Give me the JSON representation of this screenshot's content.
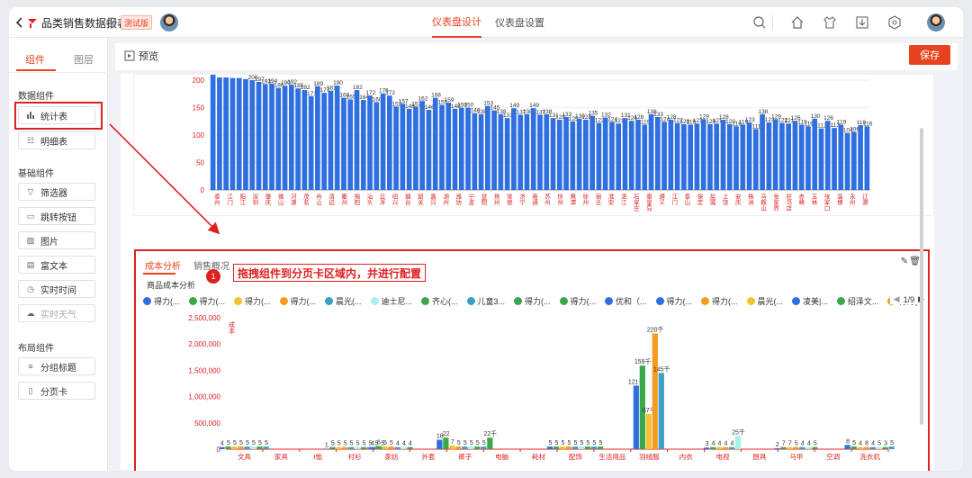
{
  "topbar": {
    "title": "品类销售数据报表",
    "badge": "测试版",
    "tabs": [
      {
        "label": "仪表盘设计",
        "active": true
      },
      {
        "label": "仪表盘设置",
        "active": false
      }
    ],
    "accent": "#e8431f"
  },
  "left_panel": {
    "tabs": [
      {
        "label": "组件",
        "active": true
      },
      {
        "label": "图层",
        "active": false
      }
    ],
    "groups": [
      {
        "title": "数据组件",
        "items": [
          {
            "label": "统计表",
            "icon": "bar-chart-icon"
          },
          {
            "label": "明细表",
            "icon": "list-icon"
          }
        ]
      },
      {
        "title": "基础组件",
        "items": [
          {
            "label": "筛选器",
            "icon": "filter-icon"
          },
          {
            "label": "跳转按钮",
            "icon": "link-button-icon"
          },
          {
            "label": "图片",
            "icon": "image-icon"
          },
          {
            "label": "富文本",
            "icon": "rich-text-icon"
          },
          {
            "label": "实时时间",
            "icon": "clock-icon"
          },
          {
            "label": "实时天气",
            "icon": "cloud-icon"
          }
        ]
      },
      {
        "title": "布局组件",
        "items": [
          {
            "label": "分组标题",
            "icon": "heading-icon"
          },
          {
            "label": "分页卡",
            "icon": "page-card-icon"
          }
        ]
      }
    ]
  },
  "toolbar": {
    "preview_label": "预览",
    "save_label": "保存"
  },
  "panel": {
    "tabs": [
      {
        "label": "成本分析",
        "active": true
      },
      {
        "label": "销售概况",
        "active": false
      }
    ],
    "callout": "拖拽组件到分页卡区域内，并进行配置",
    "callout_step": "1",
    "subtitle": "商品成本分析",
    "legend": [
      {
        "label": "得力(...",
        "color": "#2f6fe0"
      },
      {
        "label": "得力(...",
        "color": "#3aa84a"
      },
      {
        "label": "得力(...",
        "color": "#f2c230"
      },
      {
        "label": "得力(...",
        "color": "#f59a23"
      },
      {
        "label": "晨光(...",
        "color": "#3aa0c8"
      },
      {
        "label": "迪士尼...",
        "color": "#a8f0ee"
      },
      {
        "label": "齐心(...",
        "color": "#3aa84a"
      },
      {
        "label": "儿童3...",
        "color": "#3aa0c8"
      },
      {
        "label": "得力(...",
        "color": "#3aa84a"
      },
      {
        "label": "得力(...",
        "color": "#3aa84a"
      },
      {
        "label": "优和（...",
        "color": "#2f6fe0"
      },
      {
        "label": "得力(...",
        "color": "#2f6fe0"
      },
      {
        "label": "得力(...",
        "color": "#f59a23"
      },
      {
        "label": "晨光(...",
        "color": "#f2c230"
      },
      {
        "label": "凌美|...",
        "color": "#2f6fe0"
      },
      {
        "label": "绍泽文...",
        "color": "#3aa84a"
      },
      {
        "label": "得力(...",
        "color": "#f59a23"
      },
      {
        "label": "",
        "color": "#2f6fe0"
      }
    ],
    "legend_page": "1/9"
  },
  "chart_data": [
    {
      "type": "bar",
      "title": "",
      "categories": [
        "泰州",
        "江门",
        "阳江",
        "深圳",
        "肇庆",
        "佛山",
        "河源",
        "茂名",
        "舟山",
        "清远",
        "衢州",
        "揭阳",
        "汕头",
        "云浮",
        "绍兴",
        "烟台",
        "韶关",
        "嘉兴",
        "湖州",
        "潍坊",
        "宁波",
        "益阳",
        "扬州",
        "常德",
        "济宁",
        "南通",
        "苏州",
        "徐州",
        "鹰潭",
        "徐州",
        "宿迁",
        "淮安",
        "湛江",
        "石家庄",
        "秦皇岛",
        "遵义",
        "江门",
        "泰山",
        "保定",
        "盐城",
        "上饶",
        "安庆",
        "株洲",
        "马鞍山",
        "张家界",
        "驻马店",
        "赤峰",
        "玉林",
        "张家口",
        "淄博",
        "永州",
        "辽源"
      ],
      "values": [
        210,
        205,
        205,
        204,
        204,
        202,
        200,
        197,
        193,
        194,
        186,
        190,
        192,
        185,
        182,
        171,
        189,
        177,
        181,
        190,
        168,
        165,
        182,
        164,
        172,
        160,
        176,
        172,
        152,
        157,
        148,
        152,
        162,
        146,
        168,
        155,
        159,
        148,
        150,
        150,
        140,
        138,
        153,
        145,
        138,
        131,
        149,
        137,
        138,
        149,
        137,
        138,
        131,
        128,
        133,
        125,
        130,
        128,
        135,
        122,
        132,
        124,
        121,
        131,
        126,
        128,
        119,
        138,
        133,
        124,
        128,
        122,
        120,
        119,
        121,
        129,
        120,
        121,
        128,
        120,
        116,
        119,
        123,
        111,
        138,
        123,
        129,
        122,
        121,
        126,
        119,
        116,
        130,
        112,
        126,
        113,
        119,
        104,
        106,
        118,
        116
      ],
      "ylim": [
        0,
        210
      ],
      "yticks": [
        0,
        50,
        100,
        150,
        200
      ],
      "series_color": "#2f6fe0"
    },
    {
      "type": "bar",
      "title": "商品成本分析",
      "categories": [
        "文具",
        "家具",
        "t恤",
        "衬衫",
        "家纺",
        "外套",
        "裤子",
        "电脑",
        "耗材",
        "配饰",
        "生活用品",
        "羽绒服",
        "内衣",
        "电视",
        "厨具",
        "马甲",
        "空调",
        "洗衣机"
      ],
      "ylim": [
        0,
        2500000
      ],
      "yticks": [
        "0",
        "500,000",
        "1,000,000",
        "1,500,000",
        "2,000,000",
        "2,500,000"
      ],
      "ylabel": "成本",
      "groups": [
        {
          "category": "文具",
          "bars": [
            40000,
            50000,
            50000,
            50000,
            50000,
            50000,
            50000,
            50000
          ],
          "labels": [
            "4",
            "5",
            "5",
            "5",
            "5",
            "5",
            "5",
            "5"
          ]
        },
        {
          "category": "衬衫",
          "bars": [
            10000,
            40000,
            40000,
            40000,
            40000,
            40000,
            40000,
            40000,
            40000,
            40000
          ],
          "labels": [
            "1",
            "5",
            "5",
            "5",
            "5",
            "5",
            "5",
            "5",
            "5",
            "5"
          ]
        },
        {
          "category": "家纺",
          "bars": [
            40000,
            60000,
            50000,
            50000,
            40000,
            40000,
            40000
          ],
          "labels": [
            "4",
            "6",
            "5",
            "5",
            "4",
            "4",
            "4"
          ]
        },
        {
          "category": "裤子",
          "bars": [
            180000,
            220000,
            70000,
            50000,
            50000,
            50000,
            50000,
            50000,
            220000
          ],
          "labels": [
            "18",
            "22",
            "7",
            "5",
            "5",
            "5",
            "5",
            "5",
            "22千"
          ]
        },
        {
          "category": "配饰",
          "bars": [
            50000,
            50000,
            50000,
            50000,
            50000,
            50000,
            50000,
            50000,
            50000
          ],
          "labels": [
            "5",
            "5",
            "5",
            "5",
            "5",
            "5",
            "5",
            "5",
            "5"
          ]
        },
        {
          "category": "羽绒服",
          "bars": [
            1210000,
            1590000,
            670000,
            2200000,
            1450000
          ],
          "labels": [
            "121千",
            "159千",
            "67千",
            "220千",
            "145千"
          ]
        },
        {
          "category": "电视",
          "bars": [
            30000,
            40000,
            40000,
            40000,
            40000,
            250000
          ],
          "labels": [
            "3",
            "4",
            "4",
            "4",
            "4",
            "25千"
          ]
        },
        {
          "category": "马甲",
          "bars": [
            20000,
            40000,
            40000,
            40000,
            40000,
            40000,
            40000
          ],
          "labels": [
            "2",
            "7",
            "7",
            "5",
            "4",
            "4",
            "5"
          ]
        },
        {
          "category": "洗衣机",
          "bars": [
            80000,
            50000,
            40000,
            40000,
            40000,
            40000,
            40000,
            50000
          ],
          "labels": [
            "8",
            "5",
            "4",
            "8",
            "4",
            "5",
            "3",
            "5"
          ]
        }
      ]
    }
  ]
}
